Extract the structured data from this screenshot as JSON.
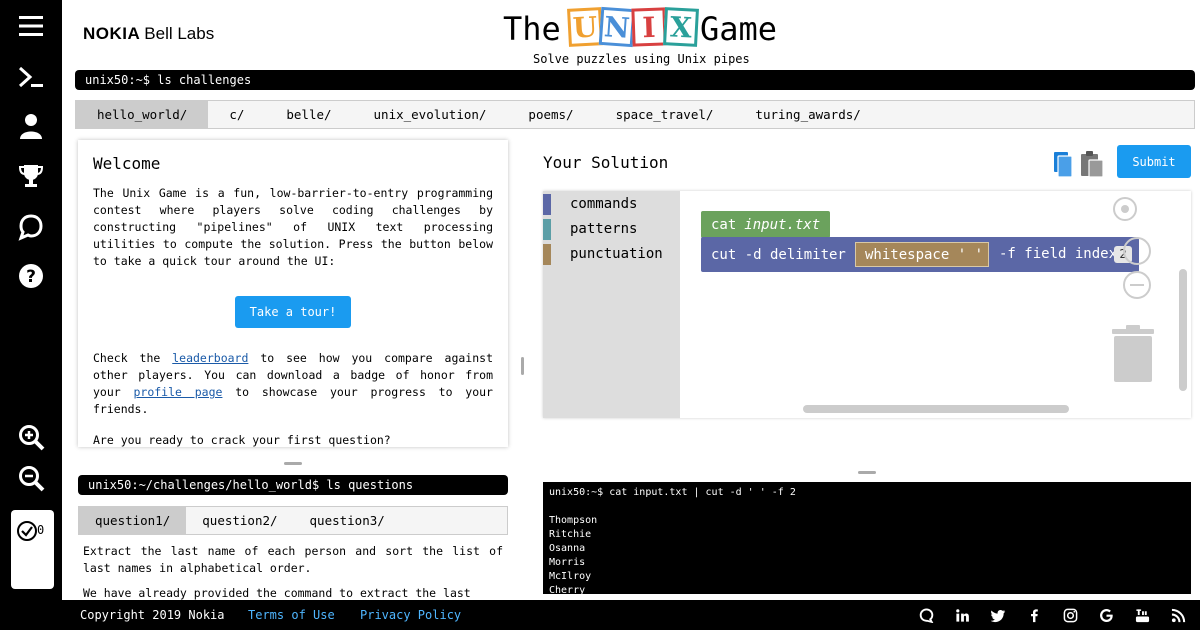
{
  "header": {
    "brand": "NOKIA",
    "lab": "Bell Labs",
    "title_prefix": "The",
    "title_blocks": [
      "U",
      "N",
      "I",
      "X"
    ],
    "title_suffix": "Game",
    "subtitle": "Solve puzzles using Unix pipes"
  },
  "sidebar": {
    "items": [
      "menu-icon",
      "terminal-icon",
      "user-icon",
      "trophy-icon",
      "chat-icon",
      "help-icon"
    ],
    "zoom": [
      "zoom-in-icon",
      "zoom-out-icon"
    ],
    "solved_count": "0"
  },
  "challenges": {
    "prompt": "unix50:~$ ls challenges",
    "tabs": [
      "hello_world/",
      "c/",
      "belle/",
      "unix_evolution/",
      "poems/",
      "space_travel/",
      "turing_awards/"
    ],
    "active_tab": "hello_world/"
  },
  "welcome": {
    "title": "Welcome",
    "intro": "The Unix Game is a fun, low-barrier-to-entry programming contest where players solve coding challenges by constructing \"pipelines\" of UNIX text processing utilities to compute the solution. Press the button below to take a quick tour around the UI:",
    "tour_button": "Take a tour!",
    "check_prefix": "Check the",
    "leaderboard_link": "leaderboard",
    "check_middle": "to see how you compare against other players. You can download a badge of honor from your",
    "profile_link": "profile page",
    "check_suffix": "to showcase your progress to your friends.",
    "ready": "Are you ready to crack your first question?"
  },
  "questions": {
    "prompt": "unix50:~/challenges/hello_world$ ls questions",
    "tabs": [
      "question1/",
      "question2/",
      "question3/"
    ],
    "active_tab": "question1/",
    "text_1": "Extract the last name of each person and sort the list of last names in alphabetical order.",
    "text_2": "We have already provided the command to extract the last"
  },
  "solution": {
    "title": "Your Solution",
    "submit": "Submit",
    "toolbox": [
      {
        "label": "commands",
        "color": "#5b67a6"
      },
      {
        "label": "patterns",
        "color": "#5b9ea6"
      },
      {
        "label": "punctuation",
        "color": "#a5875a"
      }
    ],
    "blocks": {
      "cat_cmd": "cat",
      "cat_arg": "input.txt",
      "cut_cmd": "cut -d delimiter",
      "delimiter": "whitespace ' '",
      "field_label": "-f field index",
      "field_value": "2"
    }
  },
  "terminal": {
    "command": "unix50:~$ cat input.txt | cut -d ' ' -f 2",
    "output": [
      "Thompson",
      "Ritchie",
      "Osanna",
      "Morris",
      "McIlroy",
      "Cherry"
    ]
  },
  "footer": {
    "copyright": "Copyright 2019 Nokia",
    "terms": "Terms of Use",
    "privacy": "Privacy Policy",
    "social": [
      "discourse-icon",
      "linkedin-icon",
      "twitter-icon",
      "facebook-icon",
      "instagram-icon",
      "google-icon",
      "youtube-icon",
      "rss-icon"
    ]
  },
  "colors": {
    "accent": "#1a9bf0",
    "commands": "#5b67a6",
    "patterns": "#5b9ea6",
    "punctuation": "#a5875a",
    "cat_block": "#6ba25d"
  }
}
